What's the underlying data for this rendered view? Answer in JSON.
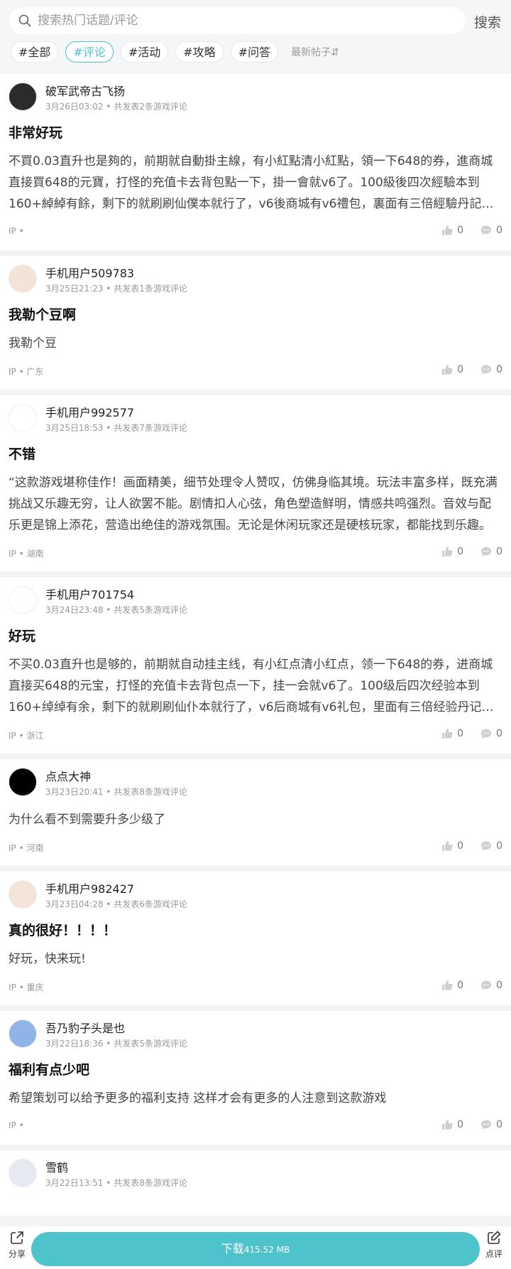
{
  "search": {
    "placeholder": "搜索热门话题/评论",
    "button": "搜索"
  },
  "filters": {
    "tags": [
      "#全部",
      "#评论",
      "#活动",
      "#攻略",
      "#问答"
    ],
    "active_index": 1,
    "sort_label": "最新帖子⇵"
  },
  "posts": [
    {
      "user": "破军武帝古飞扬",
      "meta": "3月26日03:02 • 共发表2条游戏评论",
      "title": "非常好玩",
      "body": "不買0.03直升也是夠的，前期就自動掛主線，有小紅點清小紅點，領一下648的券，進商城直接買648的元寶，打怪的充值卡去背包點一下，掛一會就v6了。100級後四次經驗本到160+綽綽有餘，剩下的就刷刷仙僕本就行了，v6後商城有v6禮包，裏面有三倍經驗丹記得用。",
      "ip": "IP •",
      "likes": "0",
      "comments": "0",
      "avatar_color": "#2b2b2b"
    },
    {
      "user": "手机用户509783",
      "meta": "3月25日21:23 • 共发表1条游戏评论",
      "title": "我勒个豆啊",
      "body": "我勒个豆",
      "ip": "IP • 广东",
      "likes": "0",
      "comments": "0",
      "avatar_color": "#f4e3d7"
    },
    {
      "user": "手机用户992577",
      "meta": "3月25日18:53 • 共发表7条游戏评论",
      "title": "不错",
      "body": "“这款游戏堪称佳作！画面精美，细节处理令人赞叹，仿佛身临其境。玩法丰富多样，既充满挑战又乐趣无穷，让人欲罢不能。剧情扣人心弦，角色塑造鲜明，情感共鸣强烈。音效与配乐更是锦上添花，营造出绝佳的游戏氛围。无论是休闲玩家还是硬核玩家，都能找到乐趣。",
      "ip": "IP • 湖南",
      "likes": "0",
      "comments": "0",
      "avatar_color": "#fff"
    },
    {
      "user": "手机用户701754",
      "meta": "3月24日23:48 • 共发表5条游戏评论",
      "title": "好玩",
      "body": "不买0.03直升也是够的，前期就自动挂主线，有小红点清小红点，领一下648的券，进商城直接买648的元宝，打怪的充值卡去背包点一下，挂一会就v6了。100级后四次经验本到160+绰绰有余，剩下的就刷刷仙仆本就行了，v6后商城有v6礼包，里面有三倍经验丹记得用。",
      "ip": "IP • 浙江",
      "likes": "0",
      "comments": "0",
      "avatar_color": "#fff"
    },
    {
      "user": "点点大神",
      "meta": "3月23日20:41 • 共发表8条游戏评论",
      "title": "",
      "body": "为什么看不到需要升多少级了",
      "ip": "IP • 河南",
      "likes": "0",
      "comments": "0",
      "avatar_color": "#000"
    },
    {
      "user": "手机用户982427",
      "meta": "3月23日04:28 • 共发表6条游戏评论",
      "title": "真的很好！！！！",
      "body": "好玩，快来玩!",
      "ip": "IP • 重庆",
      "likes": "0",
      "comments": "0",
      "avatar_color": "#f4e3d7"
    },
    {
      "user": "吾乃豹子头是也",
      "meta": "3月22日18:36 • 共发表5条游戏评论",
      "title": "福利有点少吧",
      "body": "希望策划可以给予更多的福利支持 这样才会有更多的人注意到这款游戏",
      "ip": "IP •",
      "likes": "0",
      "comments": "0",
      "avatar_color": "#8fb4e8"
    },
    {
      "user": "雪鹤",
      "meta": "3月22日13:51 • 共发表8条游戏评论",
      "title": "",
      "body": "",
      "ip": "",
      "likes": "",
      "comments": "",
      "avatar_color": "#e7e9f2"
    }
  ],
  "bottom": {
    "share": "分享",
    "download": "下载",
    "size": "415.52 MB",
    "review": "点评"
  }
}
